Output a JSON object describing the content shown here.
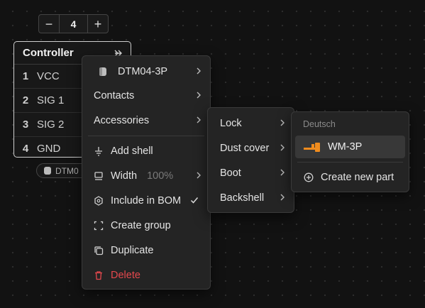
{
  "stepper": {
    "minus": "−",
    "value": "4",
    "plus": "+"
  },
  "connector": {
    "title": "Controller",
    "pins": [
      {
        "num": "1",
        "label": "VCC"
      },
      {
        "num": "2",
        "label": "SIG 1"
      },
      {
        "num": "3",
        "label": "SIG 2"
      },
      {
        "num": "4",
        "label": "GND"
      }
    ],
    "part_chip": "DTM0"
  },
  "context_menu": {
    "part": "DTM04-3P",
    "contacts": "Contacts",
    "accessories": "Accessories",
    "add_shell": "Add shell",
    "width_label": "Width",
    "width_value": "100%",
    "include_bom": "Include in BOM",
    "create_group": "Create group",
    "duplicate": "Duplicate",
    "delete": "Delete"
  },
  "accessories_menu": {
    "lock": "Lock",
    "dust_cover": "Dust cover",
    "boot": "Boot",
    "backshell": "Backshell"
  },
  "lock_menu": {
    "section": "Deutsch",
    "part": "WM-3P",
    "create": "Create new part"
  },
  "colors": {
    "accent": "#f08c1e",
    "danger": "#e5484d",
    "background": "#121212"
  }
}
